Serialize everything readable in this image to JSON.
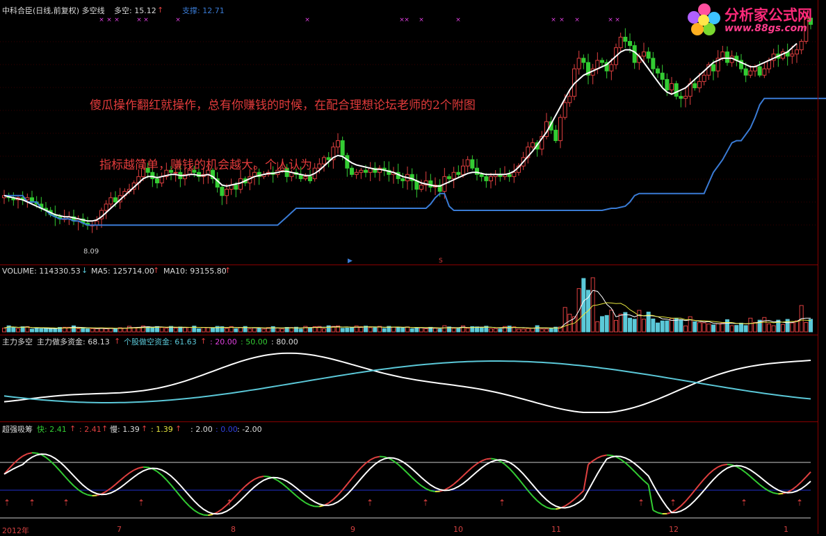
{
  "colors": {
    "background": "#000000",
    "up_candle": "#e04040",
    "down_candle": "#33cc33",
    "support_line": "#3a7bd5",
    "white_line": "#ffffff",
    "cyan": "#5bc8d8",
    "yellow": "#e8e840",
    "magenta": "#e040e0",
    "annotation": "#e23b3b"
  },
  "price_panel": {
    "title": "中科合臣(日线,前复权) 多空线",
    "duokong_label": "多空: 15.12",
    "support_label": "支撑: 12.71",
    "low_price_label": "8.09"
  },
  "annotations": {
    "line1": "傻瓜操作翻红就操作，总有你赚钱的时候，在配合理想论坛老师的2个附图",
    "line2": "指标越简单，赚钱的机会越大。个人认为"
  },
  "logo": {
    "text": "分析家公式网",
    "url": "www.88gs.com"
  },
  "volume_panel": {
    "volume_label": "VOLUME: 114330.53",
    "ma5_label": "MA5: 125714.00",
    "ma10_label": "MA10: 93155.80"
  },
  "indicator1": {
    "title": "主力多空",
    "zhuli_label": "主力做多资金: 68.13",
    "gegu_label": "个股做空资金: 61.63",
    "v1": ": 20.00",
    "v2": ": 50.00",
    "v3": ": 80.00"
  },
  "indicator2": {
    "title": "超强吸筹",
    "fast_label": "快: 2.41",
    "fast2_label": ": 2.41",
    "slow_label": "慢: 1.39",
    "slow2_label": ": 1.39",
    "v1": ": 2.00",
    "v2": ": 0.00",
    "v3": ": -2.00"
  },
  "x_axis": {
    "labels": [
      "2012年",
      "7",
      "8",
      "9",
      "10",
      "11",
      "12",
      "1"
    ]
  },
  "chart_data": {
    "type": "candlestick",
    "price_ylim": [
      7.0,
      18.5
    ],
    "close": [
      9.9,
      9.8,
      9.7,
      9.8,
      9.7,
      9.8,
      9.6,
      9.5,
      9.3,
      9.2,
      9.0,
      8.9,
      8.8,
      8.8,
      8.9,
      8.7,
      8.8,
      8.6,
      8.5,
      8.5,
      8.7,
      9.2,
      9.5,
      9.8,
      9.6,
      9.9,
      10.1,
      10.2,
      10.5,
      10.8,
      11.2,
      11.0,
      10.7,
      10.5,
      10.8,
      11.1,
      11.0,
      11.0,
      10.7,
      10.9,
      11.1,
      11.0,
      10.8,
      10.9,
      11.1,
      10.7,
      10.3,
      9.9,
      10.2,
      10.4,
      10.2,
      10.7,
      10.5,
      10.8,
      11.0,
      10.8,
      10.9,
      11.0,
      10.9,
      11.1,
      11.2,
      10.8,
      11.0,
      10.9,
      10.7,
      10.8,
      10.6,
      11.2,
      11.4,
      11.7,
      11.6,
      12.2,
      12.5,
      11.8,
      11.2,
      10.9,
      11.0,
      11.1,
      11.0,
      11.2,
      11.0,
      11.2,
      11.1,
      10.9,
      11.0,
      10.7,
      10.6,
      10.9,
      10.6,
      10.2,
      10.4,
      10.6,
      10.3,
      10.4,
      10.1,
      10.8,
      10.7,
      11.0,
      10.9,
      11.3,
      11.6,
      11.2,
      10.9,
      10.8,
      10.6,
      10.8,
      10.9,
      10.8,
      10.9,
      10.8,
      11.0,
      11.3,
      11.7,
      12.2,
      12.4,
      12.1,
      12.7,
      13.4,
      13.0,
      12.5,
      13.6,
      14.3,
      14.6,
      15.9,
      16.4,
      16.2,
      15.6,
      15.9,
      16.3,
      16.2,
      15.8,
      16.1,
      16.9,
      17.4,
      17.2,
      17.0,
      16.2,
      16.5,
      16.7,
      16.4,
      15.9,
      15.7,
      15.4,
      14.9,
      15.2,
      14.6,
      14.5,
      14.6,
      15.2,
      15.0,
      15.3,
      15.6,
      16.1,
      15.8,
      16.4,
      16.7,
      16.2,
      16.5,
      16.3,
      15.9,
      15.6,
      15.8,
      16.0,
      15.6,
      15.9,
      16.3,
      16.6,
      16.4,
      16.7,
      16.5,
      16.6,
      16.8,
      17.2,
      18.3,
      18.0
    ],
    "open": [
      9.8,
      9.9,
      9.8,
      9.7,
      9.8,
      9.7,
      9.8,
      9.6,
      9.5,
      9.3,
      9.2,
      9.0,
      8.9,
      8.8,
      8.8,
      8.9,
      8.7,
      8.8,
      8.6,
      8.5,
      8.5,
      8.8,
      9.2,
      9.5,
      9.8,
      9.6,
      9.9,
      10.1,
      10.2,
      10.5,
      10.8,
      11.2,
      11.0,
      10.7,
      10.5,
      10.8,
      11.1,
      11.0,
      11.0,
      10.7,
      10.9,
      11.1,
      11.0,
      10.8,
      10.9,
      11.1,
      10.7,
      10.3,
      9.9,
      10.2,
      10.4,
      10.2,
      10.7,
      10.5,
      10.8,
      11.0,
      10.8,
      10.9,
      11.0,
      10.9,
      11.1,
      11.2,
      10.8,
      11.0,
      10.9,
      10.7,
      10.8,
      10.7,
      11.2,
      11.4,
      11.7,
      11.6,
      12.2,
      12.5,
      11.8,
      11.2,
      10.9,
      11.0,
      11.1,
      11.0,
      11.2,
      11.0,
      11.2,
      11.1,
      10.9,
      11.0,
      10.7,
      10.6,
      10.9,
      10.6,
      10.2,
      10.4,
      10.6,
      10.3,
      10.4,
      10.1,
      10.8,
      10.7,
      11.0,
      10.9,
      11.3,
      11.6,
      11.2,
      10.9,
      10.8,
      10.6,
      10.8,
      10.9,
      10.8,
      10.9,
      10.8,
      11.0,
      11.3,
      11.7,
      12.2,
      12.4,
      12.1,
      12.7,
      13.4,
      13.0,
      12.5,
      13.6,
      14.3,
      14.6,
      15.9,
      16.4,
      16.2,
      15.6,
      15.9,
      16.3,
      16.2,
      15.8,
      16.1,
      16.9,
      17.4,
      17.2,
      17.0,
      16.2,
      16.5,
      16.7,
      16.4,
      15.9,
      15.7,
      15.4,
      14.9,
      15.2,
      14.6,
      14.5,
      14.6,
      15.2,
      15.0,
      15.3,
      15.6,
      16.1,
      15.8,
      16.4,
      16.7,
      16.2,
      16.5,
      16.3,
      15.9,
      15.6,
      15.8,
      16.0,
      15.6,
      15.9,
      16.3,
      16.6,
      16.4,
      16.7,
      16.5,
      16.6,
      16.8,
      17.2,
      18.3
    ],
    "white_line": [
      9.9,
      9.85,
      9.8,
      9.75,
      9.7,
      9.6,
      9.5,
      9.4,
      9.3,
      9.2,
      9.1,
      9.0,
      8.95,
      8.9,
      8.9,
      8.85,
      8.8,
      8.75,
      8.7,
      8.7,
      8.75,
      8.9,
      9.1,
      9.3,
      9.5,
      9.7,
      9.9,
      10.1,
      10.3,
      10.5,
      10.7,
      10.8,
      10.8,
      10.75,
      10.8,
      10.85,
      10.9,
      10.9,
      10.85,
      10.85,
      10.9,
      10.9,
      10.85,
      10.85,
      10.9,
      10.8,
      10.6,
      10.4,
      10.35,
      10.4,
      10.45,
      10.5,
      10.6,
      10.7,
      10.8,
      10.85,
      10.9,
      10.95,
      10.95,
      11.0,
      11.05,
      11.05,
      11.0,
      10.95,
      10.9,
      10.85,
      10.85,
      10.95,
      11.1,
      11.3,
      11.5,
      11.7,
      11.8,
      11.75,
      11.6,
      11.45,
      11.35,
      11.3,
      11.25,
      11.2,
      11.15,
      11.15,
      11.1,
      11.05,
      11.0,
      10.9,
      10.8,
      10.75,
      10.7,
      10.6,
      10.5,
      10.45,
      10.4,
      10.35,
      10.35,
      10.45,
      10.55,
      10.65,
      10.75,
      10.85,
      10.95,
      11.0,
      11.0,
      10.95,
      10.9,
      10.9,
      10.9,
      10.9,
      10.9,
      10.95,
      11.05,
      11.25,
      11.5,
      11.75,
      12.0,
      12.3,
      12.6,
      12.9,
      13.3,
      13.7,
      14.1,
      14.5,
      14.9,
      15.2,
      15.4,
      15.6,
      15.7,
      15.8,
      15.9,
      16.0,
      16.1,
      16.3,
      16.5,
      16.7,
      16.8,
      16.8,
      16.7,
      16.5,
      16.2,
      15.9,
      15.6,
      15.3,
      15.0,
      14.8,
      14.7,
      14.8,
      14.9,
      15.0,
      15.2,
      15.4,
      15.6,
      15.8,
      16.0,
      16.2,
      16.3,
      16.4,
      16.4,
      16.4,
      16.3,
      16.2,
      16.1,
      16.0,
      16.0,
      16.1,
      16.2,
      16.3,
      16.4,
      16.5,
      16.6,
      16.7,
      16.9,
      17.1
    ],
    "support": [
      9.9,
      9.9,
      9.9,
      9.9,
      9.9,
      9.6,
      9.6,
      9.6,
      9.3,
      9.2,
      9.0,
      8.9,
      8.8,
      8.8,
      8.8,
      8.7,
      8.7,
      8.6,
      8.5,
      8.5,
      8.5,
      8.5,
      8.5,
      8.5,
      8.5,
      8.5,
      8.5,
      8.5,
      8.5,
      8.5,
      8.5,
      8.5,
      8.5,
      8.5,
      8.5,
      8.5,
      8.5,
      8.5,
      8.5,
      8.5,
      8.5,
      8.5,
      8.5,
      8.5,
      8.5,
      8.5,
      8.5,
      8.5,
      8.5,
      8.5,
      8.5,
      8.5,
      8.5,
      8.5,
      8.5,
      8.5,
      8.5,
      8.5,
      8.5,
      8.5,
      8.7,
      8.9,
      9.1,
      9.3,
      9.3,
      9.3,
      9.3,
      9.3,
      9.3,
      9.3,
      9.3,
      9.3,
      9.3,
      9.3,
      9.3,
      9.3,
      9.3,
      9.3,
      9.3,
      9.3,
      9.3,
      9.3,
      9.3,
      9.3,
      9.3,
      9.3,
      9.3,
      9.3,
      9.3,
      9.3,
      9.3,
      9.3,
      9.5,
      9.8,
      10.0,
      10.0,
      9.4,
      9.2,
      9.2,
      9.2,
      9.2,
      9.2,
      9.2,
      9.2,
      9.2,
      9.2,
      9.2,
      9.2,
      9.2,
      9.2,
      9.2,
      9.2,
      9.2,
      9.2,
      9.2,
      9.2,
      9.2,
      9.2,
      9.2,
      9.2,
      9.2,
      9.2,
      9.2,
      9.2,
      9.2,
      9.2,
      9.2,
      9.2,
      9.2,
      9.2,
      9.25,
      9.3,
      9.3,
      9.35,
      9.4,
      9.6,
      9.9,
      10.0,
      10.0,
      10.0,
      10.0,
      10.0,
      10.0,
      10.0,
      10.0,
      10.0,
      10.0,
      10.0,
      10.0,
      10.0,
      10.0,
      10.0,
      10.5,
      11.0,
      11.3,
      11.6,
      12.0,
      12.4,
      12.5,
      12.5,
      12.8,
      13.1,
      13.6,
      14.2,
      14.5,
      14.5,
      14.5,
      14.5,
      14.5,
      14.5,
      14.5,
      14.5,
      14.5,
      14.5,
      14.5,
      14.5,
      14.5,
      14.5,
      14.5,
      14.5,
      14.5,
      14.5,
      14.5,
      14.5,
      14.5,
      14.5
    ]
  }
}
